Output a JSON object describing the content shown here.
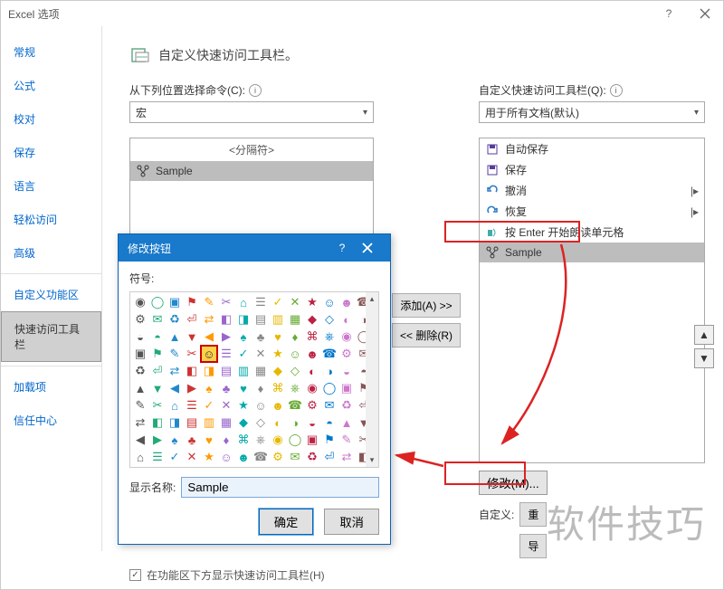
{
  "window": {
    "title": "Excel 选项"
  },
  "nav": {
    "items": [
      "常规",
      "公式",
      "校对",
      "保存",
      "语言",
      "轻松访问",
      "高级",
      "—",
      "自定义功能区",
      "快速访问工具栏",
      "—",
      "加载项",
      "信任中心"
    ],
    "active": "快速访问工具栏"
  },
  "heading": {
    "text": "自定义快速访问工具栏。"
  },
  "left": {
    "label": "从下列位置选择命令(C):",
    "select": "宏",
    "list": {
      "header": "<分隔符>",
      "item": "Sample"
    }
  },
  "right": {
    "label": "自定义快速访问工具栏(Q):",
    "select": "用于所有文档(默认)",
    "items": [
      "自动保存",
      "保存",
      "撤消",
      "恢复",
      "按 Enter 开始朗读单元格",
      "Sample"
    ],
    "modify": "修改(M)...",
    "custom_label": "自定义:",
    "reset_btn": "重",
    "export_btn": "导"
  },
  "mid": {
    "add": "添加(A) >>",
    "remove": "<< 删除(R)"
  },
  "checkbox": {
    "label": "在功能区下方显示快速访问工具栏(H)",
    "checked": true
  },
  "modal": {
    "title": "修改按钮",
    "symbol_label": "符号:",
    "name_label": "显示名称:",
    "name_value": "Sample",
    "ok": "确定",
    "cancel": "取消"
  },
  "watermark": "软件技巧"
}
